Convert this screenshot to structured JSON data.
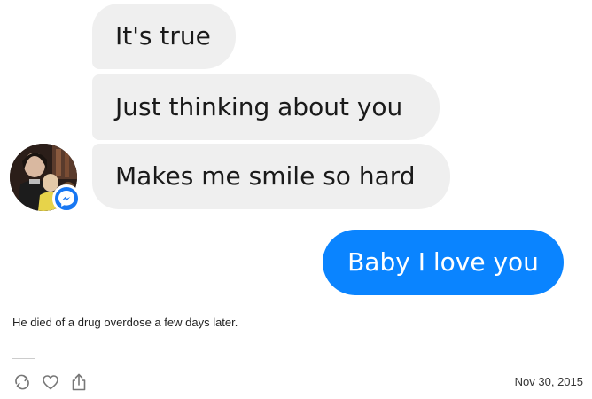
{
  "conversation": {
    "incoming": [
      {
        "text": "It's true"
      },
      {
        "text": "Just thinking about you"
      },
      {
        "text": "Makes me smile so hard"
      }
    ],
    "outgoing": [
      {
        "text": "Baby I love you"
      }
    ]
  },
  "caption": "He died of a drug overdose a few days later.",
  "post": {
    "date": "Nov 30, 2015"
  },
  "icons": {
    "reblog": "reblog-icon",
    "like": "heart-icon",
    "share": "share-icon",
    "badge": "messenger-icon"
  },
  "colors": {
    "incoming_bubble": "#efefef",
    "outgoing_bubble": "#0a84ff",
    "messenger_badge": "#1877f2"
  }
}
